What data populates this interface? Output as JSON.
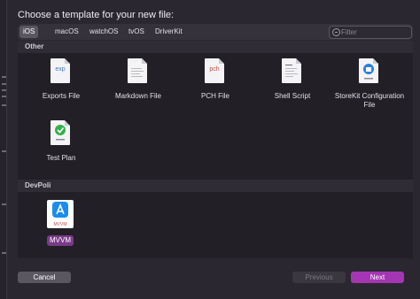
{
  "dialog": {
    "title": "Choose a template for your new file:"
  },
  "tabs": [
    {
      "label": "iOS",
      "active": true
    },
    {
      "label": "macOS",
      "active": false
    },
    {
      "label": "watchOS",
      "active": false
    },
    {
      "label": "tvOS",
      "active": false
    },
    {
      "label": "DriverKit",
      "active": false
    }
  ],
  "filter": {
    "placeholder": "Filter"
  },
  "sections": {
    "other": {
      "title": "Other",
      "items": [
        {
          "label": "Exports File",
          "icon": "exp-document-icon",
          "icon_text": "exp"
        },
        {
          "label": "Markdown File",
          "icon": "blank-document-icon"
        },
        {
          "label": "PCH File",
          "icon": "pch-document-icon",
          "icon_text": "pch"
        },
        {
          "label": "Shell Script",
          "icon": "script-document-icon"
        },
        {
          "label": "StoreKit Configuration File",
          "icon": "storekit-document-icon"
        },
        {
          "label": "Test Plan",
          "icon": "testplan-document-icon"
        }
      ]
    },
    "devpoli": {
      "title": "DevPoli",
      "items": [
        {
          "label": "MVVM",
          "icon": "mvvm-appstore-icon",
          "icon_text": "MVVM",
          "selected": true
        }
      ]
    }
  },
  "buttons": {
    "cancel": "Cancel",
    "previous": "Previous",
    "next": "Next"
  },
  "colors": {
    "accent": "#a536b3",
    "selection": "#7a3b86",
    "background": "#2a2730"
  }
}
